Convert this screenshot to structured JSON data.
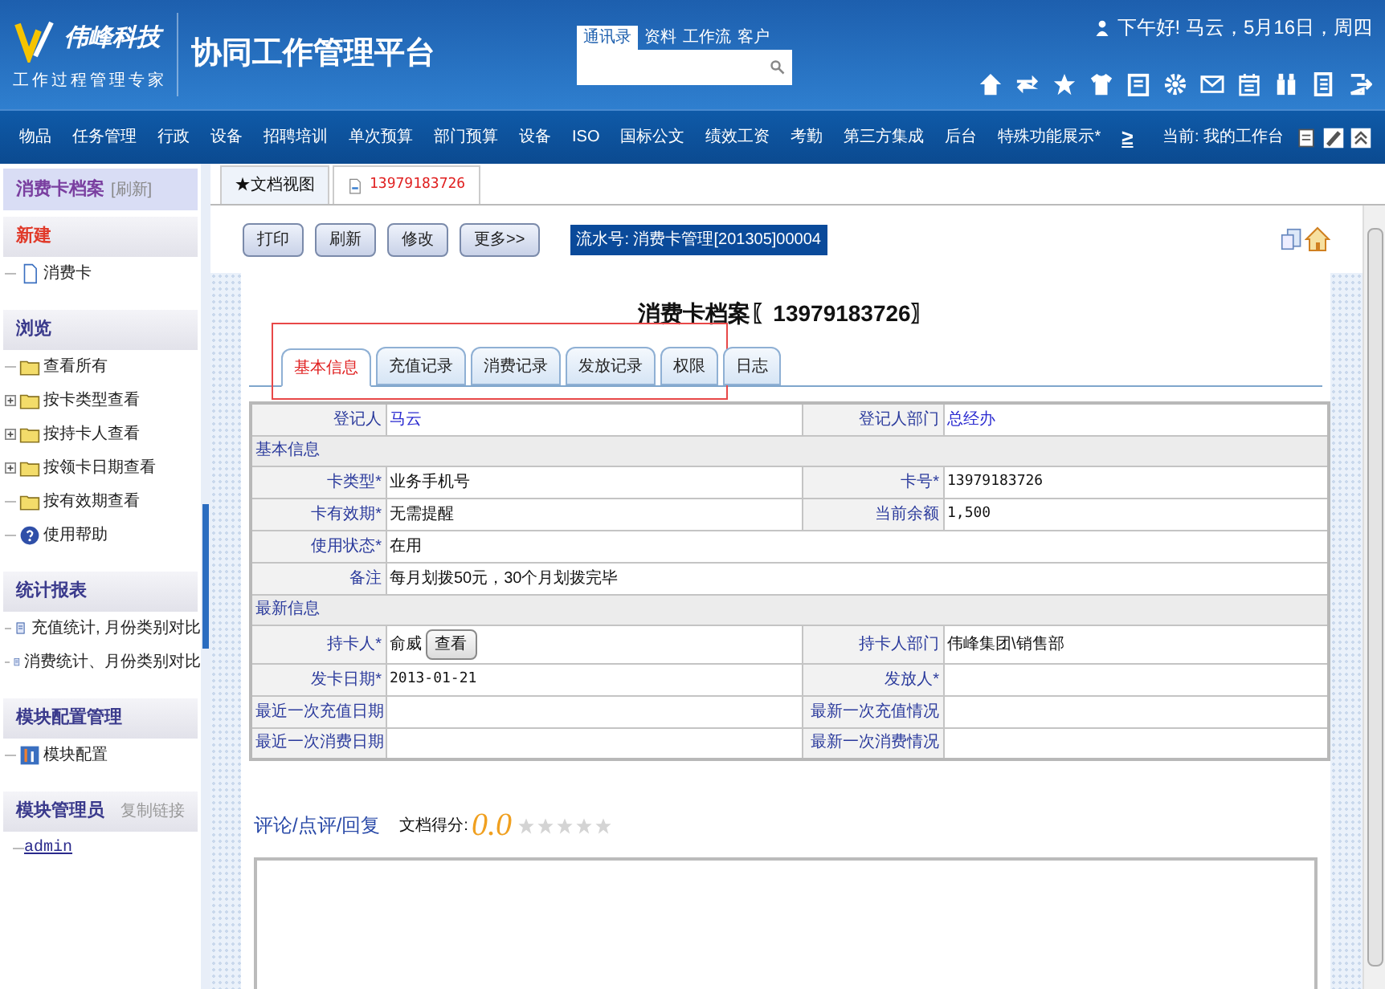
{
  "header": {
    "logo_name": "伟峰科技",
    "logo_slogan": "工作过程管理专家",
    "platform_title": "协同工作管理平台",
    "search_tabs": [
      {
        "label": "通讯录",
        "selected": true
      },
      {
        "label": "资料",
        "selected": false
      },
      {
        "label": "工作流",
        "selected": false
      },
      {
        "label": "客户",
        "selected": false
      }
    ],
    "greeting": "下午好! 马云，5月16日，周四"
  },
  "nav": {
    "items": [
      "物品",
      "任务管理",
      "行政",
      "设备",
      "招聘培训",
      "单次预算",
      "部门预算",
      "设备",
      "ISO",
      "国标公文",
      "绩效工资",
      "考勤",
      "第三方集成",
      "后台",
      "特殊功能展示*"
    ],
    "more": "≥",
    "location": "当前: 我的工作台"
  },
  "sidebar": {
    "title": "消费卡档案",
    "refresh": "[刷新]",
    "sections": [
      {
        "title": "新建",
        "kind": "new",
        "items": [
          {
            "label": "消费卡",
            "kind": "doc"
          }
        ]
      },
      {
        "title": "浏览",
        "kind": "normal",
        "items": [
          {
            "label": "查看所有",
            "kind": "folder"
          },
          {
            "label": "按卡类型查看",
            "kind": "folder",
            "expanded": false
          },
          {
            "label": "按持卡人查看",
            "kind": "folder",
            "expanded": false
          },
          {
            "label": "按领卡日期查看",
            "kind": "folder",
            "expanded": false
          },
          {
            "label": "按有效期查看",
            "kind": "folder"
          },
          {
            "label": "使用帮助",
            "kind": "help"
          }
        ]
      },
      {
        "title": "统计报表",
        "kind": "normal",
        "items": [
          {
            "label": "充值统计, 月份类别对比",
            "kind": "report"
          },
          {
            "label": "消费统计、月份类别对比",
            "kind": "report"
          }
        ]
      },
      {
        "title": "模块配置管理",
        "kind": "normal",
        "items": [
          {
            "label": "模块配置",
            "kind": "config"
          }
        ]
      },
      {
        "title": "模块管理员",
        "kind": "normal",
        "action": "复制链接",
        "items": [
          {
            "label": "admin",
            "kind": "link"
          }
        ]
      }
    ]
  },
  "doc_tabs": [
    {
      "label": "★文档视图",
      "selected": false,
      "kind": "plain"
    },
    {
      "label": "13979183726",
      "selected": true,
      "kind": "doc"
    }
  ],
  "buttons": [
    "打印",
    "刷新",
    "修改",
    "更多>>"
  ],
  "serial": "流水号: 消费卡管理[201305]00004",
  "title": "消费卡档案〖13979183726〗",
  "form_tabs": [
    {
      "label": "基本信息",
      "selected": true
    },
    {
      "label": "充值记录",
      "selected": false
    },
    {
      "label": "消费记录",
      "selected": false
    },
    {
      "label": "发放记录",
      "selected": false
    },
    {
      "label": "权限",
      "selected": false
    },
    {
      "label": "日志",
      "selected": false
    }
  ],
  "form_rows": [
    {
      "kind": "pair",
      "cells": [
        {
          "label": "登记人",
          "value": "马云",
          "link": true
        },
        {
          "label": "登记人部门",
          "value": "总经办",
          "link": true
        }
      ]
    },
    {
      "kind": "section",
      "label": "基本信息"
    },
    {
      "kind": "pair",
      "cells": [
        {
          "label": "卡类型*",
          "value": "业务手机号"
        },
        {
          "label": "卡号*",
          "value": "13979183726"
        }
      ]
    },
    {
      "kind": "pair",
      "cells": [
        {
          "label": "卡有效期*",
          "value": "无需提醒"
        },
        {
          "label": "当前余额",
          "value": "1,500"
        }
      ]
    },
    {
      "kind": "wide",
      "cells": [
        {
          "label": "使用状态*",
          "value": "在用"
        }
      ]
    },
    {
      "kind": "wide",
      "cells": [
        {
          "label": "备注",
          "value": "每月划拨50元，30个月划拨完毕"
        }
      ]
    },
    {
      "kind": "section",
      "label": "最新信息"
    },
    {
      "kind": "pair",
      "cells": [
        {
          "label": "持卡人*",
          "value": "俞威",
          "button": "查看"
        },
        {
          "label": "持卡人部门",
          "value": "伟峰集团\\销售部"
        }
      ]
    },
    {
      "kind": "pair",
      "cells": [
        {
          "label": "发卡日期*",
          "value": "2013-01-21"
        },
        {
          "label": "发放人*"
        }
      ]
    },
    {
      "kind": "pair",
      "cells": [
        {
          "label": "最近一次充值日期"
        },
        {
          "label": "最新一次充值情况"
        }
      ]
    },
    {
      "kind": "pair",
      "cells": [
        {
          "label": "最近一次消费日期"
        },
        {
          "label": "最新一次消费情况"
        }
      ]
    }
  ],
  "comments": {
    "heading": "评论/点评/回复",
    "score_label": "文档得分:",
    "score": "0.0",
    "stars": 0
  }
}
